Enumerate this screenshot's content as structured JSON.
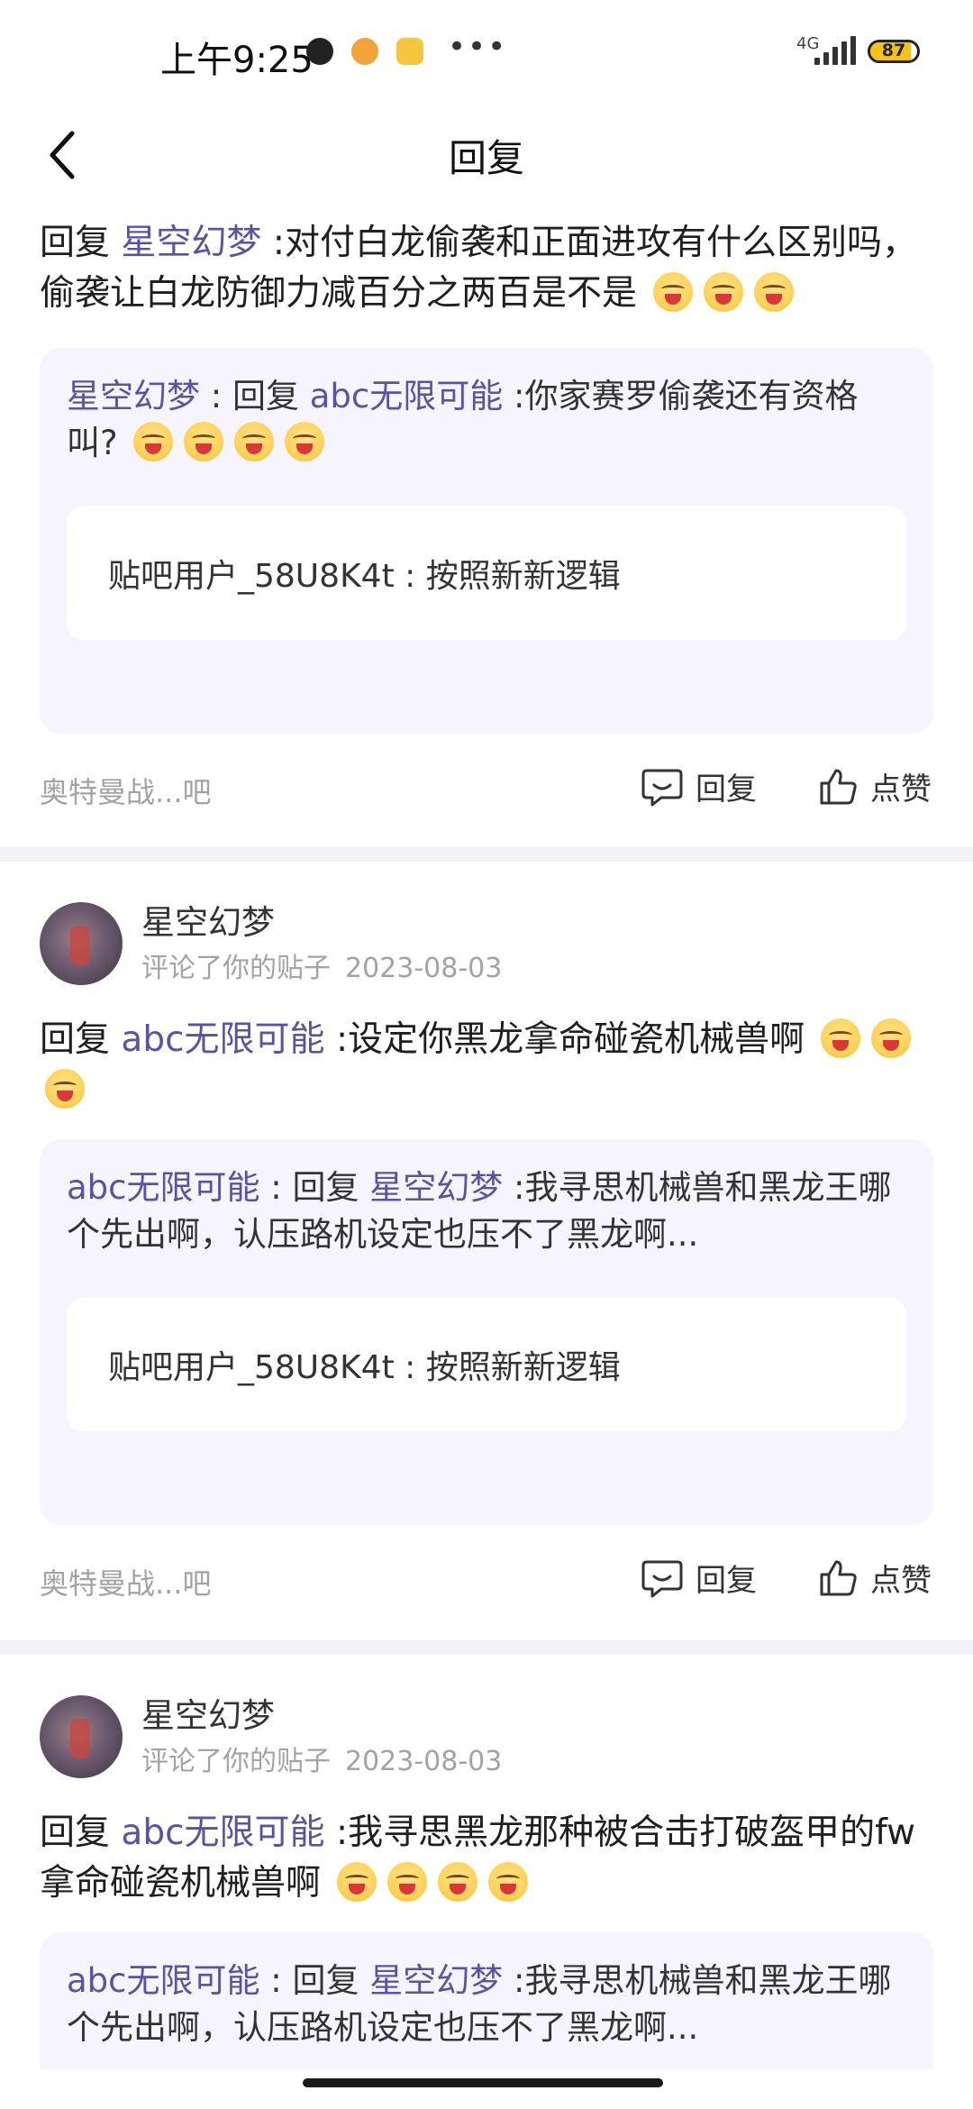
{
  "status_bar": {
    "time": "上午9:25",
    "network": "4G",
    "battery": "87",
    "battery_level": 0.87
  },
  "navbar": {
    "title": "回复"
  },
  "colors": {
    "link": "#5b52a6",
    "quote_bg": "#f5f4ff",
    "divider": "#f3f3f7",
    "meta": "#a3a3a3"
  },
  "card1": {
    "reply_prefix": "回复",
    "reply_to": "星空幻梦",
    "body": " :对付白龙偷袭和正面进攻有什么区别吗，偷袭让白龙防御力减百分之两百是不是",
    "quote": {
      "author": "星空幻梦",
      "mid": " : 回复 ",
      "target": "abc无限可能",
      "text": " :你家赛罗偷袭还有资格叫?"
    },
    "nested": "贴吧用户_58U8K4t : 按照新新逻辑",
    "forum": "奥特曼战...吧",
    "reply_label": "回复",
    "like_label": "点赞"
  },
  "card2": {
    "user_name": "星空幻梦",
    "action": "评论了你的贴子",
    "date": "2023-08-03",
    "reply_prefix": "回复",
    "reply_to": "abc无限可能",
    "body": " :设定你黑龙拿命碰瓷机械兽啊",
    "quote": {
      "author": "abc无限可能",
      "mid": " : 回复 ",
      "target": "星空幻梦",
      "text": " :我寻思机械兽和黑龙王哪个先出啊，认压路机设定也压不了黑龙啊..."
    },
    "nested": "贴吧用户_58U8K4t : 按照新新逻辑",
    "forum": "奥特曼战...吧",
    "reply_label": "回复",
    "like_label": "点赞"
  },
  "card3": {
    "user_name": "星空幻梦",
    "action": "评论了你的贴子",
    "date": "2023-08-03",
    "reply_prefix": "回复",
    "reply_to": "abc无限可能",
    "body": " :我寻思黑龙那种被合击打破盔甲的fw拿命碰瓷机械兽啊",
    "quote": {
      "author": "abc无限可能",
      "mid": " : 回复 ",
      "target": "星空幻梦",
      "text": " :我寻思机械兽和黑龙王哪个先出啊，认压路机设定也压不了黑龙啊..."
    }
  }
}
